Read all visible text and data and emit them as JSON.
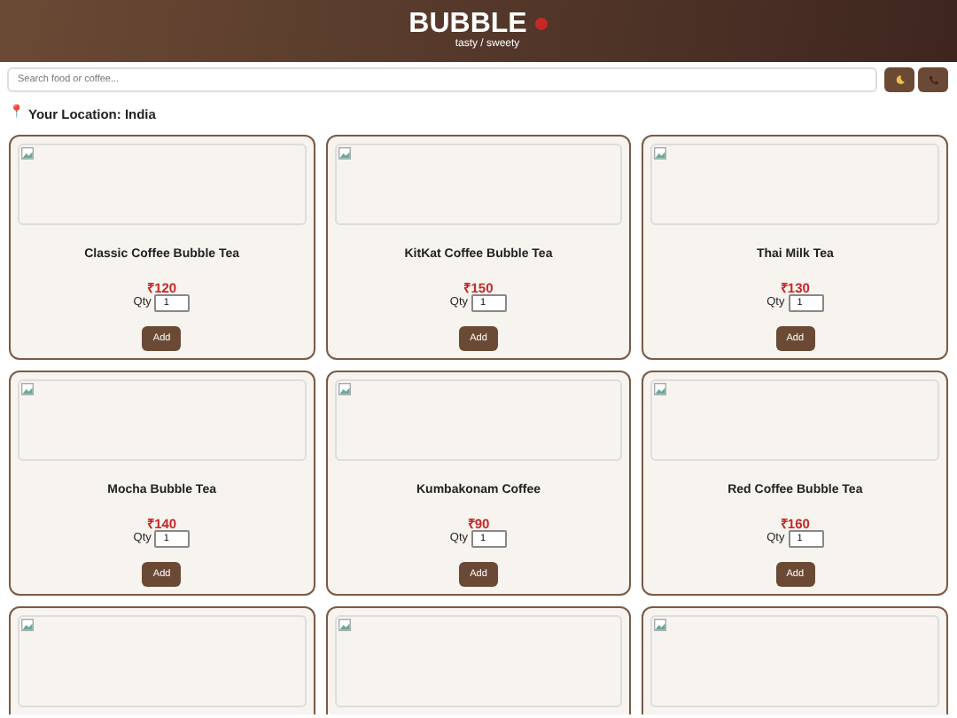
{
  "header": {
    "title": "BUBBLE",
    "subtitle": "tasty / sweety"
  },
  "search": {
    "placeholder": "Search food or coffee..."
  },
  "location": {
    "icon": "📍",
    "text": "Your Location: India"
  },
  "products": [
    {
      "kind": "full",
      "name": "Classic Coffee Bubble Tea",
      "price": "₹120",
      "qty_label": "Qty",
      "qty": "1",
      "button": "Add"
    },
    {
      "kind": "full",
      "name": "KitKat Coffee Bubble Tea",
      "price": "₹150",
      "qty_label": "Qty",
      "qty": "1",
      "button": "Add"
    },
    {
      "kind": "full",
      "name": "Thai Milk Tea",
      "price": "₹130",
      "qty_label": "Qty",
      "qty": "1",
      "button": "Add"
    },
    {
      "kind": "full",
      "name": "Mocha Bubble Tea",
      "price": "₹140",
      "qty_label": "Qty",
      "qty": "1",
      "button": "Add"
    },
    {
      "kind": "full",
      "name": "Kumbakonam Coffee",
      "price": "₹90",
      "qty_label": "Qty",
      "qty": "1",
      "button": "Add"
    },
    {
      "kind": "full",
      "name": "Red Coffee Bubble Tea",
      "price": "₹160",
      "qty_label": "Qty",
      "qty": "1",
      "button": "Add"
    },
    {
      "kind": "image_only"
    },
    {
      "kind": "image_only"
    },
    {
      "kind": "image_only"
    }
  ]
}
